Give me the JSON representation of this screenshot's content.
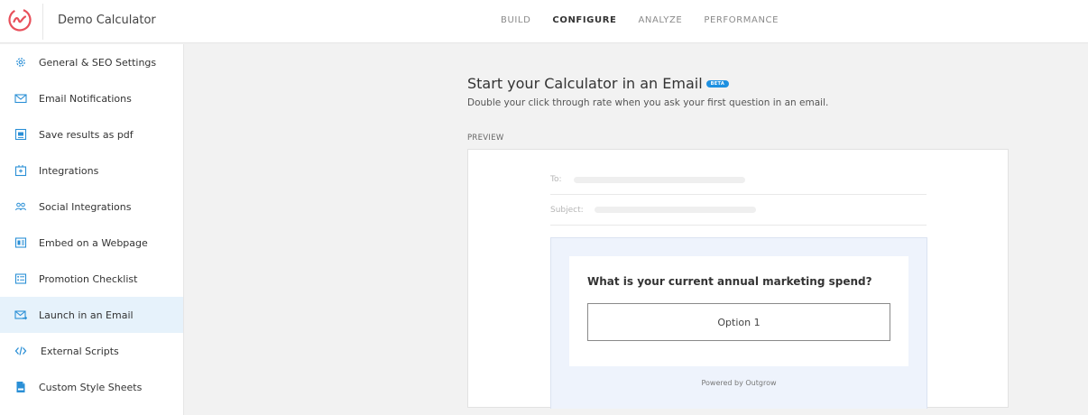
{
  "app": {
    "title": "Demo Calculator"
  },
  "nav": {
    "items": [
      {
        "label": "BUILD",
        "active": false
      },
      {
        "label": "CONFIGURE",
        "active": true
      },
      {
        "label": "ANALYZE",
        "active": false
      },
      {
        "label": "PERFORMANCE",
        "active": false
      }
    ]
  },
  "sidebar": {
    "items": [
      {
        "label": "General & SEO Settings",
        "icon": "gear-icon"
      },
      {
        "label": "Email Notifications",
        "icon": "envelope-icon"
      },
      {
        "label": "Save results as pdf",
        "icon": "pdf-icon"
      },
      {
        "label": "Integrations",
        "icon": "plug-icon"
      },
      {
        "label": "Social Integrations",
        "icon": "users-icon"
      },
      {
        "label": "Embed on a Webpage",
        "icon": "embed-icon"
      },
      {
        "label": "Promotion Checklist",
        "icon": "checklist-icon"
      },
      {
        "label": "Launch in an Email",
        "icon": "email-launch-icon",
        "active": true
      },
      {
        "label": "External Scripts",
        "icon": "code-icon"
      },
      {
        "label": "Custom Style Sheets",
        "icon": "css-file-icon"
      }
    ]
  },
  "main": {
    "title": "Start your Calculator in an Email",
    "badge": "BETA",
    "subtitle": "Double your click through rate when you ask your first question in an email.",
    "preview_label": "PREVIEW"
  },
  "preview": {
    "to_label": "To:",
    "subject_label": "Subject:",
    "question": "What is your current annual marketing spend?",
    "option": "Option 1",
    "powered_by": "Powered by Outgrow"
  },
  "colors": {
    "accent": "#1e90e0",
    "logo": "#e8505b",
    "active_bg": "#e6f2fb",
    "email_bg": "#eef3fc"
  }
}
